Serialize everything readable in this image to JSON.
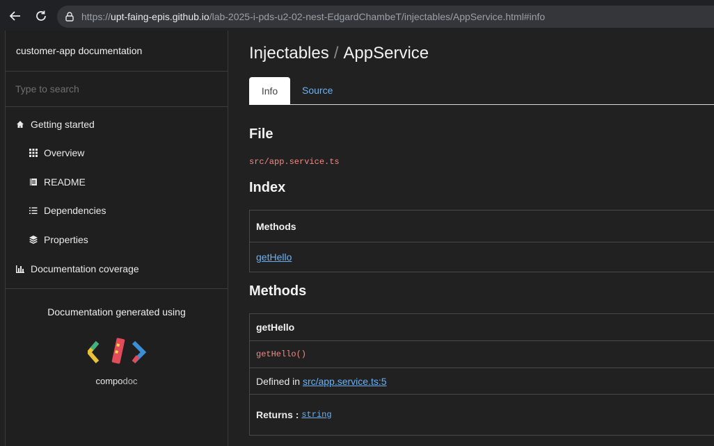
{
  "browser": {
    "url_host": "upt-faing-epis.github.io",
    "url_path": "/lab-2025-i-pds-u2-02-nest-EdgardChambeT/injectables/AppService.html#info",
    "url_scheme": "https://"
  },
  "sidebar": {
    "title": "customer-app documentation",
    "search_placeholder": "Type to search",
    "menu": [
      {
        "label": "Getting started",
        "icon": "home-icon"
      },
      {
        "label": "Overview",
        "icon": "grid-icon"
      },
      {
        "label": "README",
        "icon": "book-icon"
      },
      {
        "label": "Dependencies",
        "icon": "list-icon"
      },
      {
        "label": "Properties",
        "icon": "layers-icon"
      },
      {
        "label": "Documentation coverage",
        "icon": "bar-chart-icon"
      }
    ],
    "generated_text": "Documentation generated using",
    "logo_word_bold": "compo",
    "logo_word_light": "doc"
  },
  "content": {
    "breadcrumb_section": "Injectables",
    "breadcrumb_separator": "/",
    "breadcrumb_page": "AppService",
    "tabs": {
      "info": "Info",
      "source": "Source"
    },
    "file_heading": "File",
    "file_path": "src/app.service.ts",
    "index_heading": "Index",
    "index_table": {
      "header": "Methods",
      "link": "getHello"
    },
    "methods_heading": "Methods",
    "method": {
      "name": "getHello",
      "signature": "getHello()",
      "defined_label": "Defined in",
      "defined_link": "src/app.service.ts:5",
      "returns_label": "Returns :",
      "returns_type": "string"
    }
  },
  "colors": {
    "link": "#6bb2f4",
    "code": "#f48a82",
    "background": "#212121"
  }
}
